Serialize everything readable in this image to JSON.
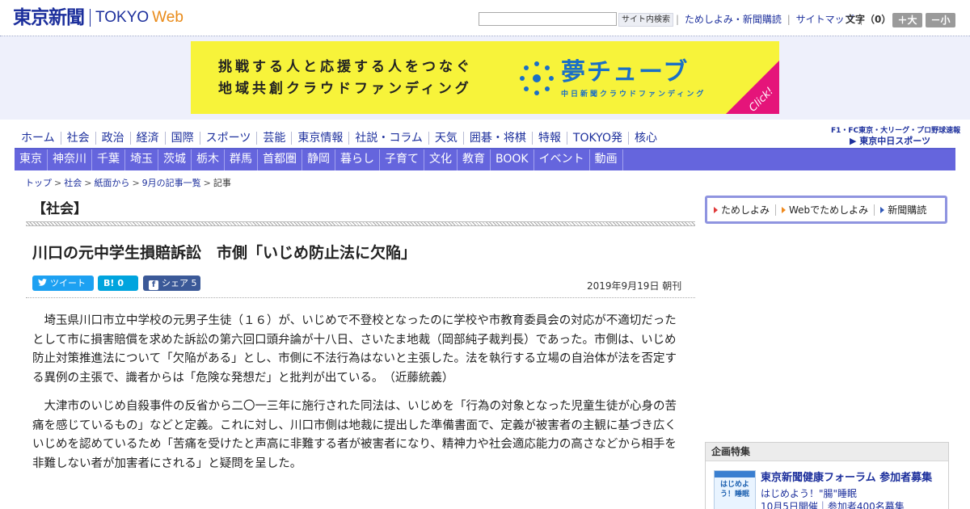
{
  "header": {
    "logo_jp": "東京新聞",
    "logo_en_1": "TOKYO",
    "logo_en_2": "Web",
    "search": {
      "placeholder": "",
      "button_label": "サイト内検索"
    },
    "util_links": [
      "ためしよみ・新聞購読",
      "サイトマップ"
    ],
    "font_label": "文字（0）",
    "font_bigger": "＋大",
    "font_smaller": "－小"
  },
  "banner": {
    "line1": "挑戦する人と応援する人をつなぐ",
    "line2": "地域共創クラウドファンディング",
    "brand": "夢チューブ",
    "brand_sub": "中日新聞クラウドファンディング",
    "click": "Click!",
    "bg_color": "#f7f33a"
  },
  "nav_primary": [
    "ホーム",
    "社会",
    "政治",
    "経済",
    "国際",
    "スポーツ",
    "芸能",
    "東京情報",
    "社説・コラム",
    "天気",
    "囲碁・将棋",
    "特報",
    "TOKYO発",
    "核心"
  ],
  "nav_regions": [
    "東京",
    "神奈川",
    "千葉",
    "埼玉",
    "茨城",
    "栃木",
    "群馬",
    "首都圏",
    "静岡",
    "暮らし",
    "子育て",
    "文化",
    "教育",
    "BOOK",
    "イベント",
    "動画"
  ],
  "sports_promo": {
    "line1": "F1・FC東京・大リーグ・プロ野球速報",
    "line2": "▶ 東京中日スポーツ"
  },
  "breadcrumb": {
    "links": [
      "トップ",
      "社会",
      "紙面から",
      "9月の記事一覧"
    ],
    "current": "記事"
  },
  "article": {
    "section": "【社会】",
    "title": "川口の元中学生損賠訴訟　市側「いじめ防止法に欠陥」",
    "date": "2019年9月19日 朝刊",
    "paragraphs": [
      "埼玉県川口市立中学校の元男子生徒（１６）が、いじめで不登校となったのに学校や市教育委員会の対応が不適切だったとして市に損害賠償を求めた訴訟の第六回口頭弁論が十八日、さいたま地裁（岡部純子裁判長）であった。市側は、いじめ防止対策推進法について「欠陥がある」とし、市側に不法行為はないと主張した。法を執行する立場の自治体が法を否定する異例の主張で、識者からは「危険な発想だ」と批判が出ている。　（近藤統義）",
      "大津市のいじめ自殺事件の反省から二〇一三年に施行された同法は、いじめを「行為の対象となった児童生徒が心身の苦痛を感じているもの」などと定義。これに対し、川口市側は地裁に提出した準備書面で、定義が被害者の主観に基づき広くいじめを認めているため「苦痛を受けたと声高に非難する者が被害者になり、精神力や社会適応能力の高さなどから相手を非難しない者が加害者にされる」と疑問を呈した。"
    ]
  },
  "social": {
    "tweet": "ツイート",
    "hatena_icon": "B!",
    "hatena_count": "0",
    "facebook_icon": "f",
    "share": "シェア",
    "share_count": "5"
  },
  "sidebar": {
    "subscribe_links": [
      "ためしよみ",
      "Webでためしよみ",
      "新聞購読"
    ],
    "feature": {
      "heading": "企画特集",
      "thumb_text": "はじめよう！睡眠",
      "title": "東京新聞健康フォーラム 参加者募集",
      "sub": "はじめよう！\"腸\"睡眠",
      "sub2": "10月5日開催｜参加者400名募集"
    }
  }
}
